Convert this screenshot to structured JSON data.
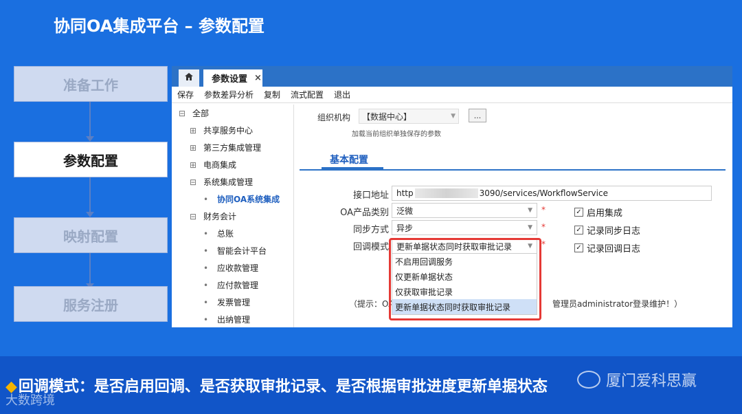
{
  "slide": {
    "title": "协同OA集成平台 – 参数配置",
    "caption_prefix": "◆",
    "caption": "回调模式：是否启用回调、是否获取审批记录、是否根据审批进度更新单据状态",
    "watermark_left": "大数跨境",
    "watermark_right": "厦门爱科思赢"
  },
  "steps": [
    {
      "label": "准备工作",
      "active": false
    },
    {
      "label": "参数配置",
      "active": true
    },
    {
      "label": "映射配置",
      "active": false
    },
    {
      "label": "服务注册",
      "active": false
    }
  ],
  "app": {
    "tabs": {
      "home_icon": "home-icon",
      "active_tab": "参数设置",
      "close": "×"
    },
    "toolbar": [
      "保存",
      "参数差异分析",
      "复制",
      "流式配置",
      "退出"
    ],
    "tree": [
      {
        "icon": "⊟",
        "label": "全部",
        "indent": 0
      },
      {
        "icon": "⊞",
        "label": "共享服务中心",
        "indent": 1
      },
      {
        "icon": "⊞",
        "label": "第三方集成管理",
        "indent": 1
      },
      {
        "icon": "⊞",
        "label": "电商集成",
        "indent": 1
      },
      {
        "icon": "⊟",
        "label": "系统集成管理",
        "indent": 1
      },
      {
        "icon": "•",
        "label": "协同OA系统集成",
        "indent": 2,
        "selected": true
      },
      {
        "icon": "⊟",
        "label": "财务会计",
        "indent": 1
      },
      {
        "icon": "•",
        "label": "总账",
        "indent": 2
      },
      {
        "icon": "•",
        "label": "智能会计平台",
        "indent": 2
      },
      {
        "icon": "•",
        "label": "应收款管理",
        "indent": 2
      },
      {
        "icon": "•",
        "label": "应付款管理",
        "indent": 2
      },
      {
        "icon": "•",
        "label": "发票管理",
        "indent": 2
      },
      {
        "icon": "•",
        "label": "出纳管理",
        "indent": 2
      }
    ],
    "org": {
      "label": "组织机构",
      "value": "【数据中心】",
      "button": "...",
      "hint": "加载当前组织单独保存的参数"
    },
    "section": {
      "tab": "基本配置"
    },
    "form": {
      "interface_label": "接口地址",
      "interface_prefix": "http",
      "interface_suffix": "3090/services/WorkflowService",
      "oa_type_label": "OA产品类别",
      "oa_type_value": "泛微",
      "sync_label": "同步方式",
      "sync_value": "异步",
      "callback_label": "回调模式",
      "callback_value": "更新单据状态同时获取审批记录",
      "required_mark": "*"
    },
    "checkboxes": [
      {
        "label": "启用集成",
        "checked": true
      },
      {
        "label": "记录同步日志",
        "checked": true
      },
      {
        "label": "记录回调日志",
        "checked": true
      }
    ],
    "dropdown_options": [
      {
        "label": "不启用回调服务",
        "selected": false
      },
      {
        "label": "仅更新单据状态",
        "selected": false
      },
      {
        "label": "仅获取审批记录",
        "selected": false
      },
      {
        "label": "更新单据状态同时获取审批记录",
        "selected": true
      }
    ],
    "note_prefix": "（提示：OA",
    "note_suffix": "管理员administrator登录维护！）"
  },
  "colors": {
    "background": "#1a6fe0",
    "accent": "#2c72c7",
    "highlight": "#e53935",
    "caption_band": "#1155c8"
  }
}
